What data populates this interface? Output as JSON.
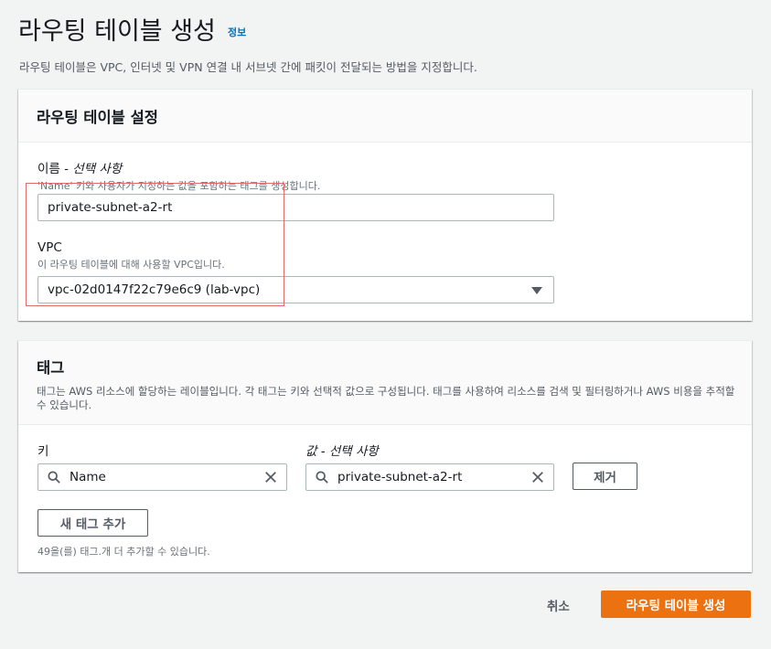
{
  "header": {
    "title": "라우팅 테이블 생성",
    "info_link": "정보",
    "description": "라우팅 테이블은 VPC, 인터넷 및 VPN 연결 내 서브넷 간에 패킷이 전달되는 방법을 지정합니다."
  },
  "settings": {
    "title": "라우팅 테이블 설정",
    "name_label": "이름 - ",
    "name_optional": "선택 사항",
    "name_desc": "'Name' 키와 사용자가 지정하는 값을 포함하는 태그를 생성합니다.",
    "name_value": "private-subnet-a2-rt",
    "vpc_label": "VPC",
    "vpc_desc": "이 라우팅 테이블에 대해 사용할 VPC입니다.",
    "vpc_value": "vpc-02d0147f22c79e6c9 (lab-vpc)"
  },
  "tags": {
    "title": "태그",
    "description": "태그는 AWS 리소스에 할당하는 레이블입니다. 각 태그는 키와 선택적 값으로 구성됩니다. 태그를 사용하여 리소스를 검색 및 필터링하거나 AWS 비용을 추적할 수 있습니다.",
    "key_label": "키",
    "value_label": "값 - ",
    "value_optional": "선택 사항",
    "key_value": "Name",
    "value_value": "private-subnet-a2-rt",
    "remove_button": "제거",
    "add_button": "새 태그 추가",
    "remaining_text": "49을(를) 태그.개 더 추가할 수 있습니다."
  },
  "footer": {
    "cancel": "취소",
    "create": "라우팅 테이블 생성"
  },
  "colors": {
    "primary": "#ec7211",
    "link": "#0073bb",
    "highlight": "#e06b6b"
  }
}
